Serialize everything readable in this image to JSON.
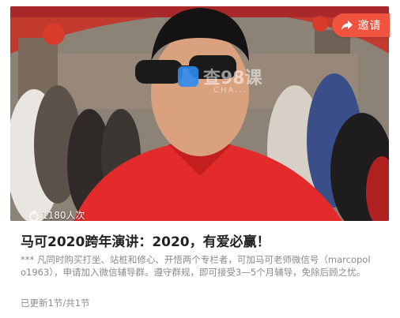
{
  "hero": {
    "invite_label": "邀请",
    "view_count": "1180人次",
    "watermark_text": "查98课",
    "watermark_sub": "CHA..."
  },
  "course": {
    "title": "马可2020跨年演讲：2020，有爱必赢！",
    "description": "*** 凡同时购买打坐、站桩和修心、开悟两个专栏者，可加马可老师微信号（marcopolo1963），申请加入微信辅导群。遵守群规，即可接受3—5个月辅导，免除后顾之忧。",
    "progress": "已更新1节/共1节"
  },
  "colors": {
    "accent": "#f0533e",
    "title": "#222222",
    "muted": "#8a8a8a"
  },
  "icons": {
    "invite": "share-arrow-icon",
    "views": "fire-icon"
  }
}
